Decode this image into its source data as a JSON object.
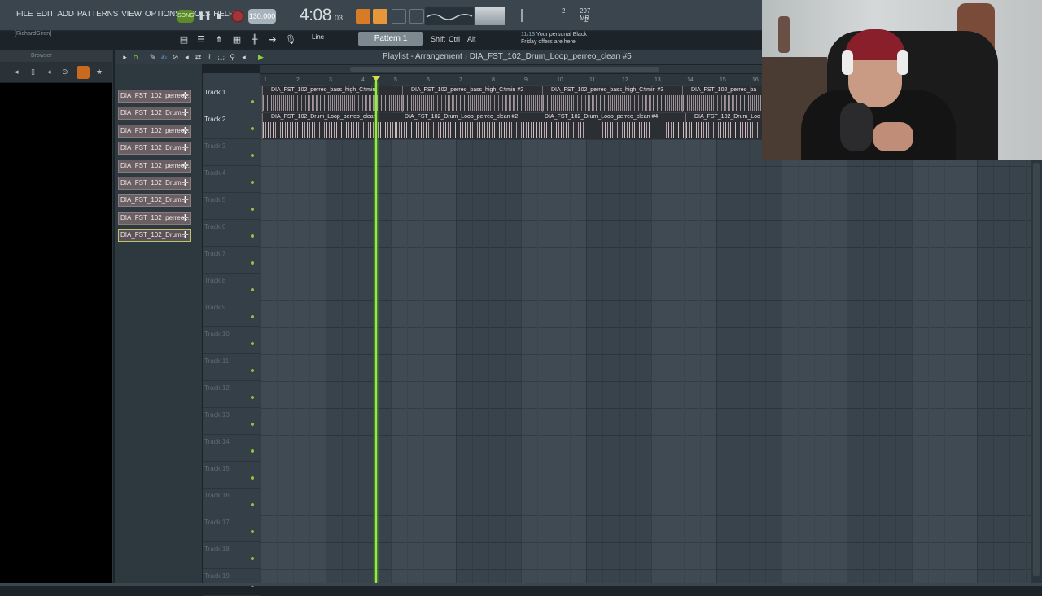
{
  "menu": [
    "FILE",
    "EDIT",
    "ADD",
    "PATTERNS",
    "VIEW",
    "OPTIONS",
    "TOOLS",
    "HELP"
  ],
  "transport": {
    "mode": "SONG",
    "tempo": "130.000",
    "time_main": "4:08",
    "time_sub": "03"
  },
  "cpu": {
    "cpu": "2",
    "memory": "297 MB",
    "polyphony": "2"
  },
  "user_tag": "[RichardGiron]",
  "toolbar": {
    "snap": "Line",
    "pattern": "Pattern 1",
    "keys": [
      "Shift",
      "Ctrl",
      "Alt"
    ],
    "news_date": "11/13",
    "news_text_1": "Your personal Black",
    "news_text_2": "Friday offers are here"
  },
  "browser": {
    "title": "Browser"
  },
  "picker_items": [
    "DIA_FST_102_perreo...",
    "DIA_FST_102_Drum...",
    "DIA_FST_102_perreo...",
    "DIA_FST_102_Drum...",
    "DIA_FST_102_perreo...",
    "DIA_FST_102_Drum...",
    "DIA_FST_102_Drum...",
    "DIA_FST_102_perreo...",
    "DIA_FST_102_Drum..."
  ],
  "playlist": {
    "title": "Playlist - Arrangement",
    "separator": "›",
    "current_clip": "DIA_FST_102_Drum_Loop_perreo_clean #5"
  },
  "ruler": [
    "1",
    "2",
    "3",
    "4",
    "5",
    "6",
    "7",
    "8",
    "9",
    "10",
    "11",
    "12",
    "13",
    "14",
    "15",
    "16"
  ],
  "tracks": [
    "Track 1",
    "Track 2",
    "Track 3",
    "Track 4",
    "Track 5",
    "Track 6",
    "Track 7",
    "Track 8",
    "Track 9",
    "Track 10",
    "Track 11",
    "Track 12",
    "Track 13",
    "Track 14",
    "Track 15",
    "Track 16",
    "Track 17",
    "Track 18",
    "Track 19"
  ],
  "clips_track1": [
    "DIA_FST_102_perreo_bass_high_C#min",
    "DIA_FST_102_perreo_bass_high_C#min #2",
    "DIA_FST_102_perreo_bass_high_C#min #3",
    "DIA_FST_102_perreo_ba"
  ],
  "clips_track2": [
    "DIA_FST_102_Drum_Loop_perreo_clean",
    "DIA_FST_102_Drum_Loop_perreo_clean #2",
    "DIA_FST_102_Drum_Loop_perreo_clean #4",
    "DIA_FST_102_Drum_Loo"
  ],
  "colors": {
    "playhead": "#90f036",
    "clip_header": "#7a6f73",
    "accent": "#c96a1e"
  }
}
